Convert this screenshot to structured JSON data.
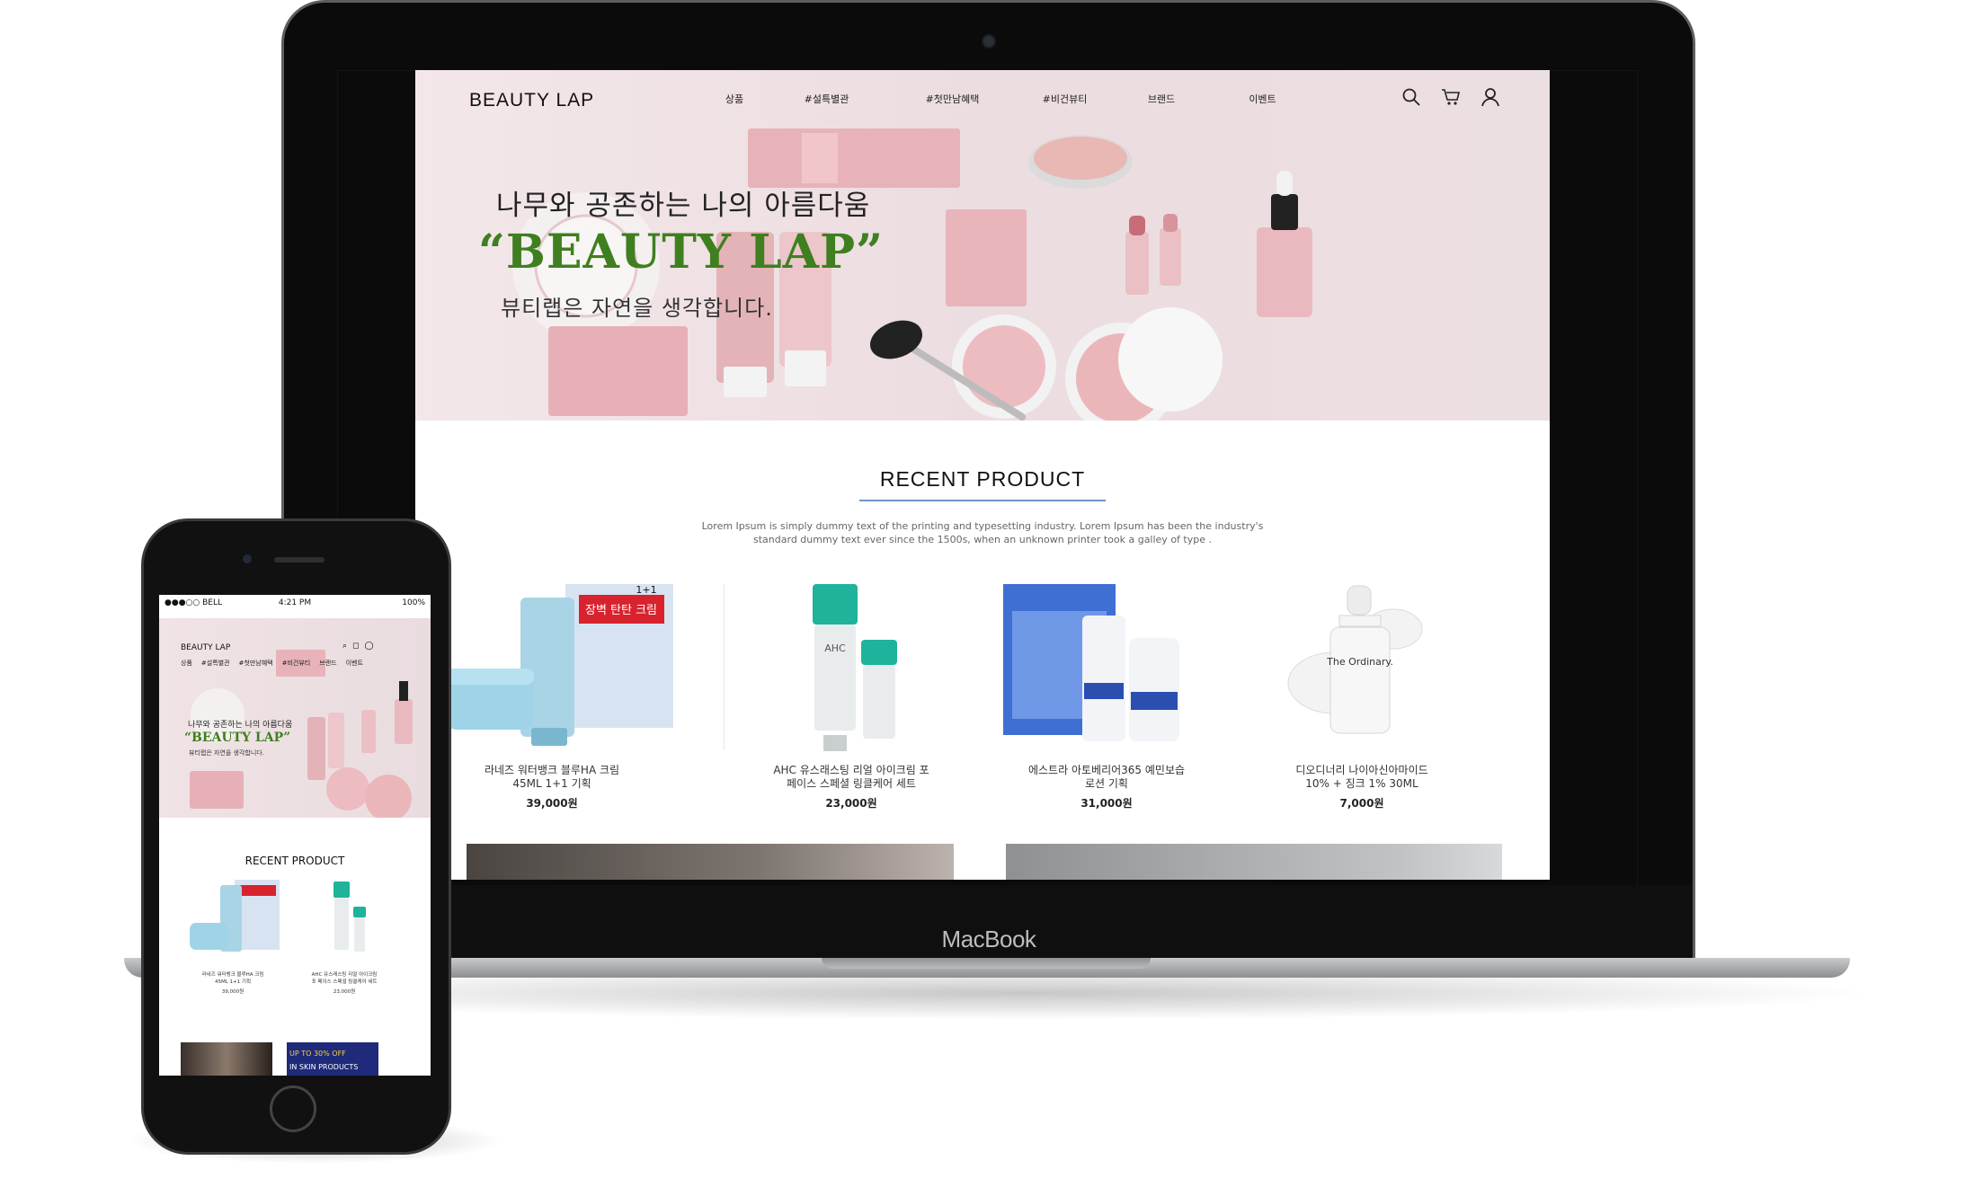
{
  "laptop": {
    "brand_label": "MacBook",
    "nav": {
      "logo": "BEAUTY LAP",
      "menu": [
        "상품",
        "#설특별관",
        "#첫만남혜택",
        "#비건뷰티",
        "브랜드",
        "이벤트"
      ],
      "icons": [
        "search-icon",
        "cart-icon",
        "user-icon"
      ]
    },
    "hero": {
      "headline": "나무와 공존하는 나의 아름다움",
      "brand_quote": "“BEAUTY LAP”",
      "subline": "뷰티랩은 자연을 생각합니다.",
      "colors": {
        "background": "#eedfe2",
        "brand_green": "#3f7f1f",
        "accent_pink": "#e9b9bf"
      }
    },
    "recent": {
      "title": "RECENT PRODUCT",
      "description_line1": "Lorem Ipsum is simply dummy text of the printing and typesetting industry. Lorem Ipsum has been the industry's",
      "description_line2": "standard dummy text ever since the 1500s, when an unknown printer took a galley of type .",
      "products": [
        {
          "name_line1": "라네즈 워터뱅크 블루HA 크림",
          "name_line2": "45ML 1+1 기획",
          "price": "39,000원",
          "label_lines": [
            "1+1",
            "장벽 탄탄 크림"
          ]
        },
        {
          "name_line1": "AHC 유스래스팅 리얼 아이크림 포",
          "name_line2": "페이스 스페셜 링클케어 세트",
          "price": "23,000원",
          "label_lines": [
            "AHC"
          ]
        },
        {
          "name_line1": "에스트라 아토베리어365 예민보습",
          "name_line2": "로션 기획",
          "price": "31,000원",
          "label_lines": []
        },
        {
          "name_line1": "디오디너리 나이아신아마이드",
          "name_line2": "10% + 징크 1% 30ML",
          "price": "7,000원",
          "label_lines": [
            "The Ordinary."
          ]
        }
      ]
    }
  },
  "phone": {
    "status": {
      "carrier": "●●●○○ BELL",
      "time": "4:21 PM",
      "battery": "100%"
    },
    "nav": {
      "logo": "BEAUTY LAP",
      "menu": [
        "상품",
        "#설특별관",
        "#첫만남혜택",
        "#비건뷰티",
        "브랜드",
        "이벤트"
      ]
    },
    "hero": {
      "headline": "나무와 공존하는 나의 아름다움",
      "brand_quote": "“BEAUTY LAP”",
      "subline": "뷰티랩은 자연을 생각합니다."
    },
    "recent": {
      "title": "RECENT PRODUCT",
      "products": [
        {
          "name_line1": "라네즈 워터뱅크 블루HA 크림",
          "name_line2": "45ML 1+1 기획",
          "price": "39,000원"
        },
        {
          "name_line1": "AHC 유스래스팅 리얼 아이크림",
          "name_line2": "포 페이스 스페셜 링클케어 세트",
          "price": "23,000원"
        }
      ]
    },
    "banner": {
      "line1": "UP TO 30% OFF",
      "line2": "IN SKIN PRODUCTS"
    }
  }
}
